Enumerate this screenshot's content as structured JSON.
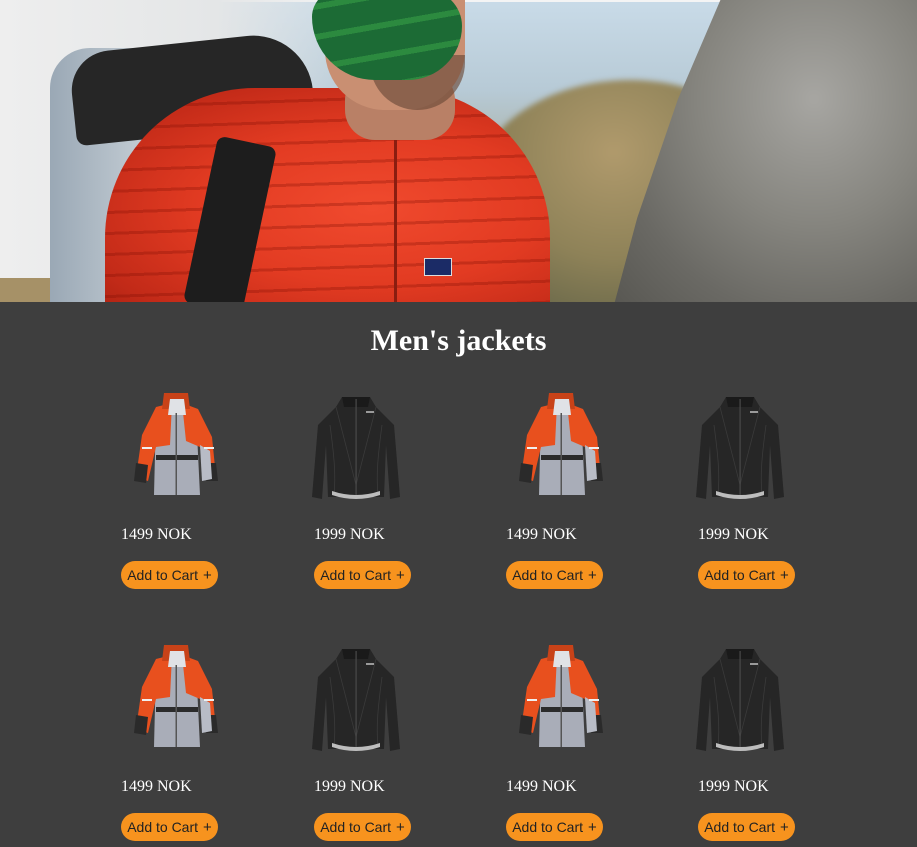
{
  "page": {
    "title": "Men's jackets"
  },
  "products": [
    {
      "type": "orange-grey",
      "price": "1499 NOK",
      "button": "Add to Cart",
      "button_icon": "+"
    },
    {
      "type": "black",
      "price": "1999 NOK",
      "button": "Add to Cart",
      "button_icon": "+"
    },
    {
      "type": "orange-grey",
      "price": "1499 NOK",
      "button": "Add to Cart",
      "button_icon": "+"
    },
    {
      "type": "black",
      "price": "1999 NOK",
      "button": "Add to Cart",
      "button_icon": "+"
    },
    {
      "type": "orange-grey",
      "price": "1499 NOK",
      "button": "Add to Cart",
      "button_icon": "+"
    },
    {
      "type": "black",
      "price": "1999 NOK",
      "button": "Add to Cart",
      "button_icon": "+"
    },
    {
      "type": "orange-grey",
      "price": "1499 NOK",
      "button": "Add to Cart",
      "button_icon": "+"
    },
    {
      "type": "black",
      "price": "1999 NOK",
      "button": "Add to Cart",
      "button_icon": "+"
    }
  ],
  "colors": {
    "background": "#3e3e3e",
    "button": "#f7931e",
    "text": "#ffffff"
  }
}
